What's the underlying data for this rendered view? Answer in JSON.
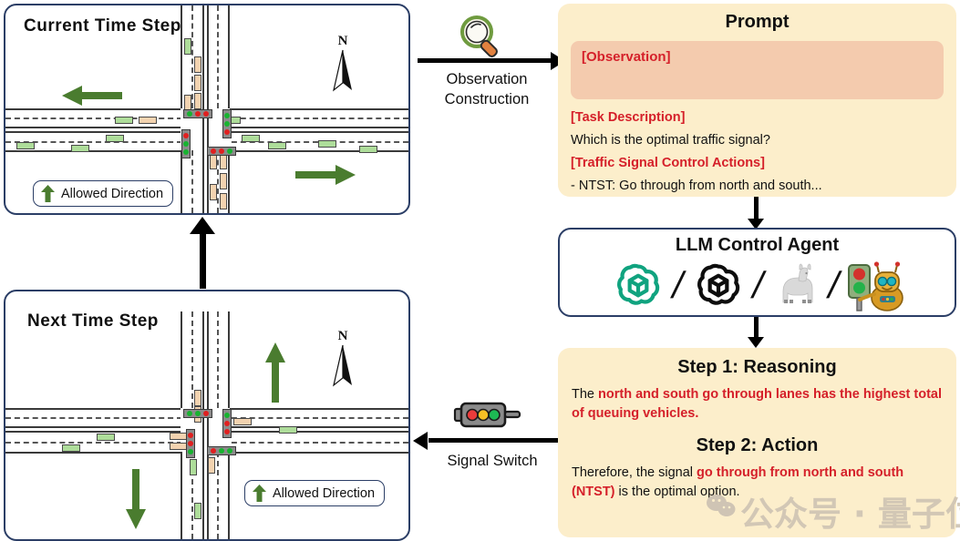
{
  "panels": {
    "current": {
      "title": "Current Time Step",
      "legend_label": "Allowed Direction",
      "compass": "N"
    },
    "next": {
      "title": "Next Time Step",
      "legend_label": "Allowed Direction",
      "compass": "N"
    }
  },
  "connectors": {
    "observation": {
      "line1": "Observation",
      "line2": "Construction",
      "icon": "magnifier-icon"
    },
    "signal_switch": {
      "label": "Signal Switch",
      "icon": "traffic-light-icon"
    }
  },
  "prompt": {
    "title": "Prompt",
    "observation_tag": "[Observation]",
    "task_tag": "[Task Description]",
    "task_text": "Which is the optimal traffic signal?",
    "actions_tag": "[Traffic Signal Control Actions]",
    "action_item": "- NTST: Go through from north and south..."
  },
  "agent": {
    "title": "LLM Control Agent",
    "separator": "/",
    "models": [
      {
        "name": "openai-green-logo-icon"
      },
      {
        "name": "openai-black-logo-icon"
      },
      {
        "name": "llama-icon"
      },
      {
        "name": "traffic-robot-icon"
      }
    ]
  },
  "response": {
    "step1_title": "Step 1: Reasoning",
    "reasoning_pre": "The ",
    "reasoning_red": "north and south go through lanes has the highest total of queuing vehicles.",
    "step2_title": "Step 2: Action",
    "action_pre": "Therefore, the signal ",
    "action_red": "go through from north and south (NTST)",
    "action_post": " is the optimal option."
  },
  "watermark": {
    "text": "公众号 · 量子位"
  },
  "colors": {
    "panel_border": "#2b3e66",
    "card_bg": "#fceecb",
    "observation_bg": "#f4cbae",
    "accent_red": "#d5202a",
    "arrow_green": "#4a7c2f",
    "vehicle_go": "#aedd9a",
    "vehicle_queue": "#f3d3b0",
    "lamp_red": "#e02020",
    "lamp_green": "#18b330"
  }
}
